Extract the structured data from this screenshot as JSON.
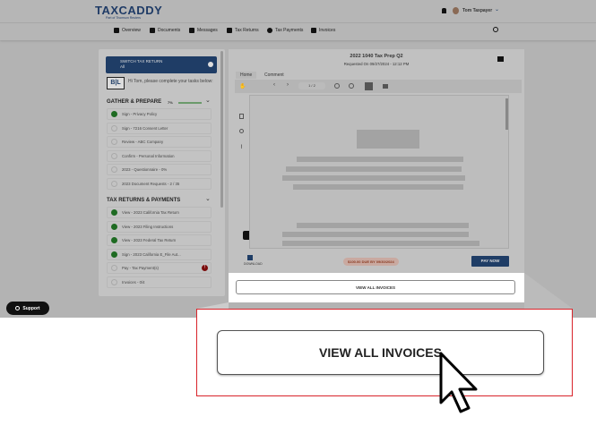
{
  "header": {
    "logo": "TAXCADDY",
    "logo_sub": "Part of Thomson Reuters",
    "user": "Tom Taxpayer"
  },
  "nav": [
    "Overview",
    "Documents",
    "Messages",
    "Tax Returns",
    "Tax Payments",
    "Invoices"
  ],
  "sidebar": {
    "switch_title": "SWITCH TAX RETURN",
    "switch_value": "All",
    "firm": "B|L",
    "greeting": "Hi Tom, please complete your tasks below:",
    "gather": {
      "title": "GATHER & PREPARE",
      "progress_label": "7%",
      "progress": 7,
      "items": [
        {
          "label": "Sign - Privacy Policy",
          "done": true
        },
        {
          "label": "Sign - 7216 Consent Letter",
          "done": false
        },
        {
          "label": "Review - ABC Company",
          "done": false
        },
        {
          "label": "Confirm - Personal Information",
          "done": false
        },
        {
          "label": "2023 - Questionnaire - 0%",
          "done": false
        },
        {
          "label": "2023 Document Requests - 2 / 35",
          "done": false
        }
      ]
    },
    "returns": {
      "title": "TAX RETURNS & PAYMENTS",
      "items": [
        {
          "label": "View - 2023 California Tax Return",
          "done": true
        },
        {
          "label": "View - 2023 Filing Instructions",
          "done": true
        },
        {
          "label": "View - 2023 Federal Tax Return",
          "done": true
        },
        {
          "label": "Sign - 2023 California E_File Aut...",
          "done": true
        },
        {
          "label": "Pay - Tax Payment(s)",
          "done": false,
          "badge": "!"
        },
        {
          "label": "Invoices - 0/4",
          "done": false
        }
      ]
    }
  },
  "doc": {
    "title": "2022 1040 Tax Prep Q2",
    "requested": "Requested On 09/27/2024 - 12:12 PM",
    "tabs": [
      "Home",
      "Comment"
    ],
    "page": "1 / 2",
    "download": "DOWNLOAD",
    "due": "$100.00 DUE BY 09/30/2024",
    "pay": "PAY NOW",
    "view_all": "VIEW ALL INVOICES"
  },
  "callout": {
    "view_all": "VIEW ALL INVOICES"
  },
  "support": "Support"
}
